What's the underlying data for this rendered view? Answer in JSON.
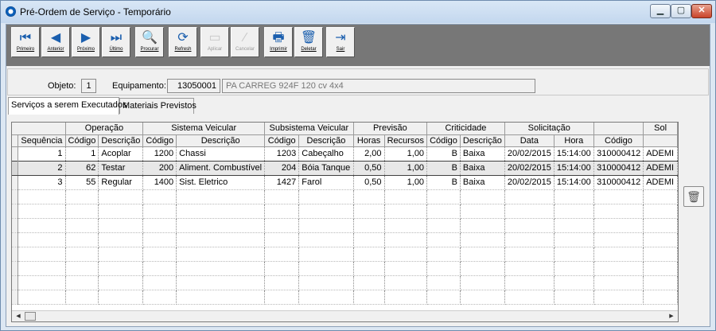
{
  "window": {
    "title": "Pré-Ordem de Serviço - Temporário"
  },
  "toolbar": {
    "buttons": [
      {
        "label": "Primeiro",
        "icon": "first-icon",
        "glyph": "⏮",
        "enabled": true
      },
      {
        "label": "Anterior",
        "icon": "prev-icon",
        "glyph": "◀",
        "enabled": true
      },
      {
        "label": "Próximo",
        "icon": "next-icon",
        "glyph": "▶",
        "enabled": true
      },
      {
        "label": "Último",
        "icon": "last-icon",
        "glyph": "⏭",
        "enabled": true
      },
      {
        "label": "Procurar",
        "icon": "search-icon",
        "glyph": "🔍",
        "enabled": true
      },
      {
        "label": "Refresh",
        "icon": "refresh-icon",
        "glyph": "⟳",
        "enabled": true
      },
      {
        "label": "Aplicar",
        "icon": "apply-icon",
        "glyph": "▭",
        "enabled": false
      },
      {
        "label": "Cancelar",
        "icon": "cancel-icon",
        "glyph": "⁄",
        "enabled": false
      },
      {
        "label": "Imprimir",
        "icon": "print-icon",
        "glyph": "🖶",
        "enabled": true
      },
      {
        "label": "Deletar",
        "icon": "delete-icon",
        "glyph": "🗑",
        "enabled": true
      },
      {
        "label": "Sair",
        "icon": "exit-icon",
        "glyph": "⇥",
        "enabled": true
      }
    ]
  },
  "header": {
    "objeto_label": "Objeto:",
    "objeto_value": "1",
    "equipamento_label": "Equipamento:",
    "equipamento_code": "13050001",
    "equipamento_desc": "PA CARREG 924F 120 cv 4x4"
  },
  "tabs": [
    {
      "label": "Serviços a serem Executados",
      "active": true
    },
    {
      "label": "Materiais Previstos",
      "active": false
    }
  ],
  "grid": {
    "groups": [
      "",
      "Operação",
      "Sistema Veicular",
      "Subsistema Veicular",
      "Previsão",
      "Criticidade",
      "Solicitação",
      "",
      "Sol"
    ],
    "columns": [
      "Sequência",
      "Código",
      "Descrição",
      "Código",
      "Descrição",
      "Código",
      "Descrição",
      "Horas",
      "Recursos",
      "Código",
      "Descrição",
      "Data",
      "Hora",
      "Código",
      ""
    ],
    "rows": [
      [
        "1",
        "1",
        "Acoplar",
        "1200",
        "Chassi",
        "1203",
        "Cabeçalho",
        "2,00",
        "1,00",
        "B",
        "Baixa",
        "20/02/2015",
        "15:14:00",
        "310000412",
        "ADEMI"
      ],
      [
        "2",
        "62",
        "Testar",
        "200",
        "Aliment. Combustível",
        "204",
        "Bóia Tanque",
        "0,50",
        "1,00",
        "B",
        "Baixa",
        "20/02/2015",
        "15:14:00",
        "310000412",
        "ADEMI"
      ],
      [
        "3",
        "55",
        "Regular",
        "1400",
        "Sist. Eletrico",
        "1427",
        "Farol",
        "0,50",
        "1,00",
        "B",
        "Baixa",
        "20/02/2015",
        "15:14:00",
        "310000412",
        "ADEMI"
      ]
    ],
    "selected_row": 1
  },
  "colors": {
    "toolbar_bg": "#777777",
    "titlebar": "#c3d7ee"
  }
}
